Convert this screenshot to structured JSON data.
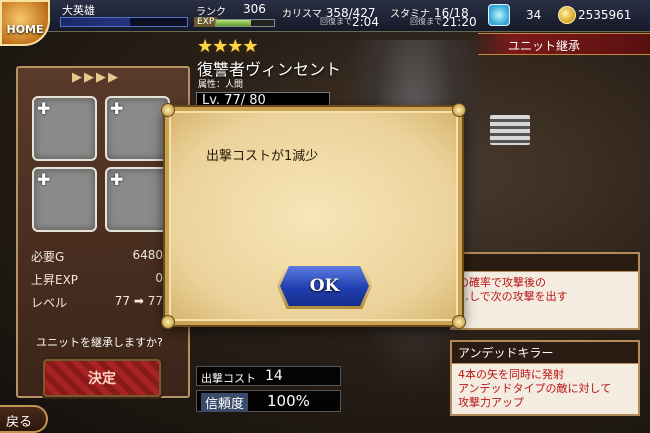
{
  "header": {
    "home_label": "HOME",
    "player_name": "大英雄",
    "rank_label": "ランク",
    "rank_value": "306",
    "exp_label": "EXP",
    "exp_progress": 0.6,
    "charisma_label": "カリスマ",
    "charisma_value": "358/427",
    "charisma_sub": "回復まで",
    "charisma_time": "2:04",
    "stamina_label": "スタミナ",
    "stamina_value": "16/18",
    "stamina_sub": "回復まで",
    "stamina_time": "21:20",
    "crystals": "34",
    "gold": "2535961"
  },
  "screen_title": "ユニット継承",
  "left_panel": {
    "required_gold_label": "必要G",
    "required_gold_value": "6480",
    "exp_gain_label": "上昇EXP",
    "exp_gain_value": "0",
    "level_label": "レベル",
    "level_value": "77 ➡ 77",
    "confirm_question": "ユニットを継承しますか?",
    "decide_label": "決定"
  },
  "unit": {
    "stars": "★★★★",
    "name": "復讐者ヴィンセント",
    "attribute": "属性：人間",
    "level": "Lv. 77/ 80",
    "cost_label": "出撃コスト",
    "cost_value": "14",
    "trust_label": "信頼度",
    "trust_value": "100%"
  },
  "skills": [
    {
      "name": "",
      "description": "の確率で攻撃後の\n…しで次の攻撃を出す"
    },
    {
      "name": "アンデッドキラー",
      "description": "4本の矢を同時に発射\nアンデッドタイプの敵に対して\n攻撃力アップ"
    }
  ],
  "back_label": "戻る",
  "modal": {
    "message": "出撃コストが1減少",
    "ok_label": "OK"
  }
}
